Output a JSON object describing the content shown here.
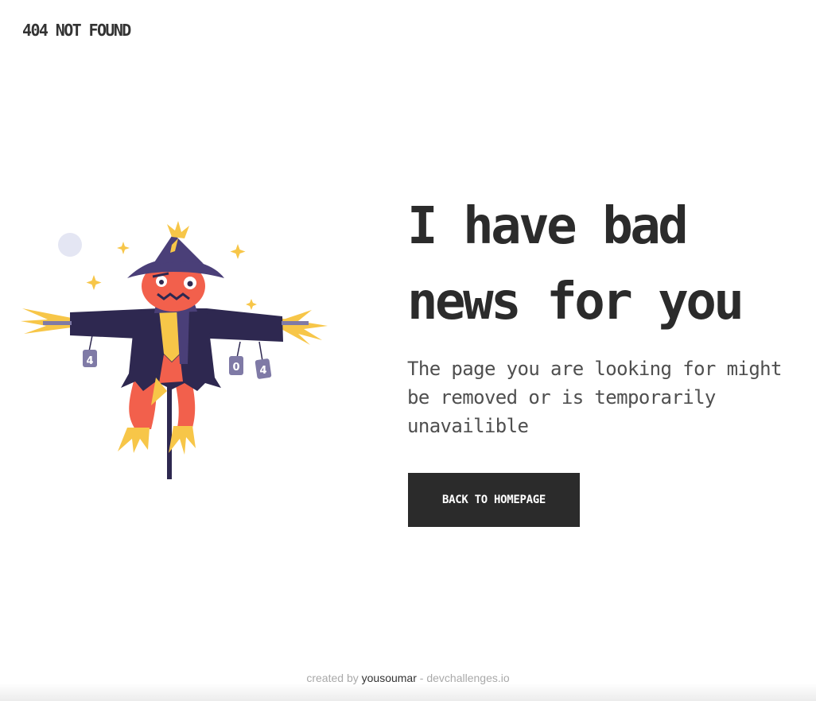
{
  "header": {
    "brand": "404 NOT FOUND"
  },
  "illustration": {
    "can_labels": [
      "4",
      "0",
      "4"
    ]
  },
  "main": {
    "headline": "I have bad news for you",
    "description": "The page you are looking for might be removed or is temporarily unavailible",
    "button_label": "BACK TO HOMEPAGE"
  },
  "footer": {
    "prefix": "created by",
    "author": "yousoumar",
    "separator": " - ",
    "site": "devchallenges.io"
  },
  "colors": {
    "text_dark": "#2b2b2b",
    "button_bg": "#2b2b2b",
    "scarecrow_hat": "#4a3f78",
    "scarecrow_coat": "#2e2850",
    "scarecrow_face": "#f2604c",
    "straw": "#f7c648",
    "moon": "#e4e6f3"
  }
}
